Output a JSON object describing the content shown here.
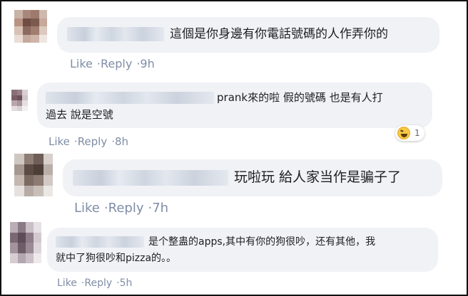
{
  "comments": [
    {
      "text": "這個是你身邊有你電話號碼的人作弄你的",
      "like": "Like",
      "reply": "Reply",
      "time": "9h"
    },
    {
      "text_line1": "prank來的啦 假的號碼 也是有人打",
      "text_line2": "過去 說是空號",
      "like": "Like",
      "reply": "Reply",
      "time": "8h",
      "reaction_count": "1"
    },
    {
      "text": "玩啦玩 給人家当作是骗子了",
      "like": "Like",
      "reply": "Reply",
      "time": "7h"
    },
    {
      "text_line1": "是个整蛊的apps,其中有你的狗很吵，还有其他，我",
      "text_line2": "就中了狗很吵和pizza的。。",
      "like": "Like",
      "reply": "Reply",
      "time": "5h"
    }
  ]
}
